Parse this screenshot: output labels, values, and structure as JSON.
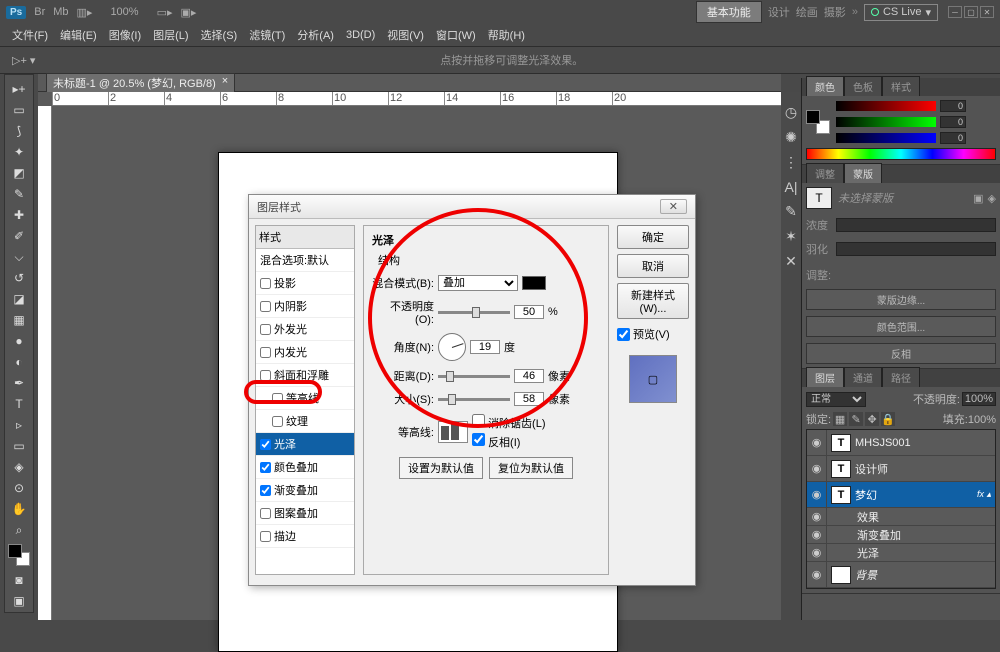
{
  "top": {
    "zoom": "100%",
    "basic": "基本功能",
    "design": "设计",
    "paint": "绘画",
    "photo": "摄影",
    "cslive": "CS Live"
  },
  "menu": [
    "文件(F)",
    "编辑(E)",
    "图像(I)",
    "图层(L)",
    "选择(S)",
    "滤镜(T)",
    "分析(A)",
    "3D(D)",
    "视图(V)",
    "窗口(W)",
    "帮助(H)"
  ],
  "opt_msg": "点按并拖移可调整光泽效果。",
  "doc_tab": "未标题-1 @ 20.5% (梦幻, RGB/8)",
  "ruler": [
    "0",
    "2",
    "4",
    "6",
    "8",
    "10",
    "12",
    "14",
    "16",
    "18",
    "20"
  ],
  "color_panel": {
    "tabs": [
      "颜色",
      "色板",
      "样式"
    ],
    "r": "0",
    "g": "0",
    "b": "0"
  },
  "adj_panel": {
    "tabs": [
      "调整",
      "蒙版"
    ],
    "hint": "未选择蒙版",
    "density": "浓度",
    "feather": "羽化",
    "adjust": "调整:",
    "btn1": "蒙版边缘...",
    "btn2": "颜色范围...",
    "btn3": "反相"
  },
  "layers_panel": {
    "tabs": [
      "图层",
      "通道",
      "路径"
    ],
    "mode": "正常",
    "opacity_lbl": "不透明度:",
    "opacity": "100%",
    "lock_lbl": "锁定:",
    "fill_lbl": "填充:",
    "fill": "100%",
    "layers": [
      {
        "name": "MHSJS001",
        "txt": true
      },
      {
        "name": "设计师",
        "txt": true
      },
      {
        "name": "梦幻",
        "txt": true,
        "sel": true,
        "fx": true
      },
      {
        "name": "背景",
        "txt": false,
        "italic": true
      }
    ],
    "fx_lbl": "效果",
    "fx1": "渐变叠加",
    "fx2": "光泽"
  },
  "dialog": {
    "title": "图层样式",
    "styles_hdr": "样式",
    "blend_opt": "混合选项:默认",
    "list": [
      "投影",
      "内阴影",
      "外发光",
      "内发光",
      "斜面和浮雕",
      "等高线",
      "纹理",
      "光泽",
      "颜色叠加",
      "渐变叠加",
      "图案叠加",
      "描边"
    ],
    "selected": 7,
    "checked": [
      false,
      false,
      false,
      false,
      false,
      false,
      false,
      true,
      true,
      true,
      false,
      false
    ],
    "section": "光泽",
    "struct": "结构",
    "blend_mode_lbl": "混合模式(B):",
    "blend_mode": "叠加",
    "opacity_lbl": "不透明度(O):",
    "opacity": "50",
    "opacity_unit": "%",
    "angle_lbl": "角度(N):",
    "angle": "19",
    "angle_unit": "度",
    "dist_lbl": "距离(D):",
    "dist": "46",
    "dist_unit": "像素",
    "size_lbl": "大小(S):",
    "size": "58",
    "size_unit": "像素",
    "contour_lbl": "等高线:",
    "antialias": "消除锯齿(L)",
    "invert": "反相(I)",
    "default1": "设置为默认值",
    "default2": "复位为默认值",
    "ok": "确定",
    "cancel": "取消",
    "newstyle": "新建样式(W)...",
    "preview": "预览(V)"
  }
}
